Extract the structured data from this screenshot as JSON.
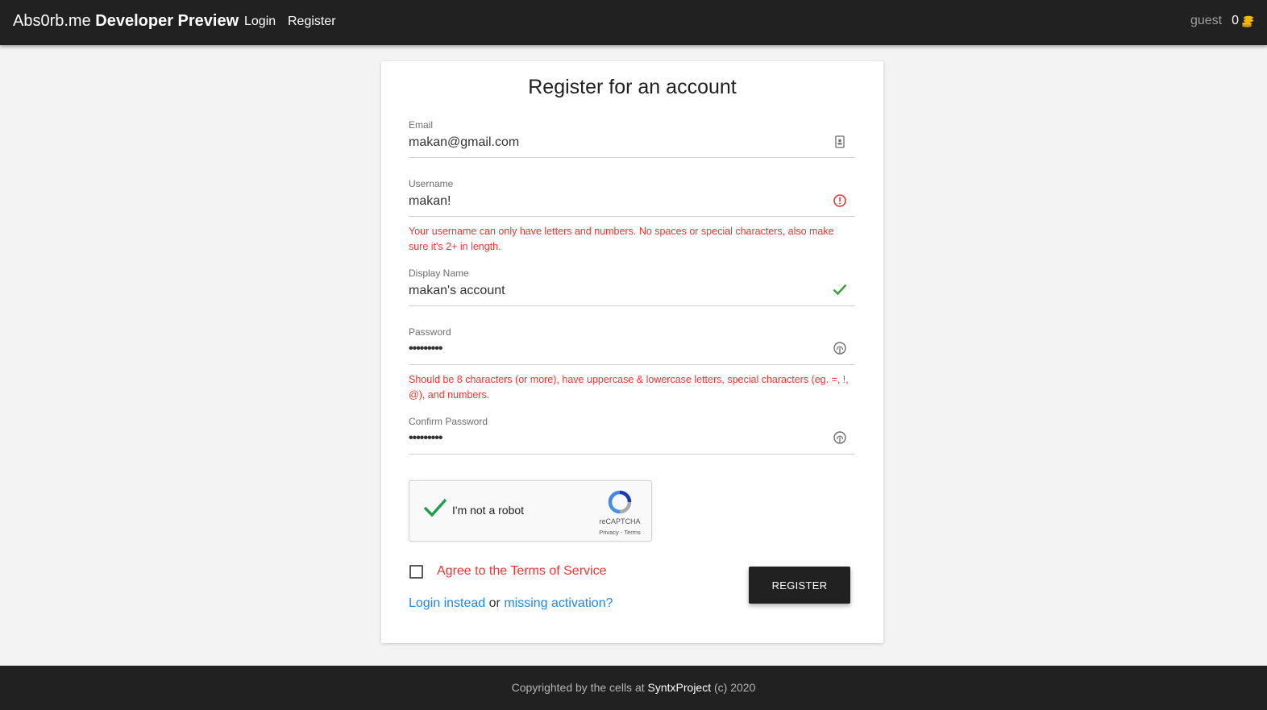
{
  "header": {
    "brand_name": "Abs0rb.me",
    "brand_suffix": "Developer Preview",
    "nav": [
      {
        "label": "Login"
      },
      {
        "label": "Register"
      }
    ],
    "user_name": "guest",
    "coin_count": "0",
    "coin_icon": "coins-icon",
    "accent_color": "#f5b800"
  },
  "form": {
    "title": "Register for an account",
    "fields": {
      "email": {
        "label": "Email",
        "value": "makan@gmail.com",
        "icon": "contact-card-icon"
      },
      "username": {
        "label": "Username",
        "value": "makan!",
        "icon": "error-icon",
        "error": "Your username can only have letters and numbers. No spaces or special characters, also make sure it's 2+ in length."
      },
      "display_name": {
        "label": "Display Name",
        "value": "makan's account",
        "icon": "check-icon"
      },
      "password": {
        "label": "Password",
        "value": "•••••••••",
        "icon": "fingerprint-icon",
        "error": "Should be 8 characters (or more), have uppercase & lowercase letters, special characters (eg. =, !, @), and numbers."
      },
      "confirm_password": {
        "label": "Confirm Password",
        "value": "•••••••••",
        "icon": "fingerprint-icon"
      }
    },
    "captcha": {
      "label": "I'm not a robot",
      "brand": "reCAPTCHA",
      "links": "Privacy - Terms",
      "checked": true
    },
    "terms": {
      "label": "Agree to the Terms of Service",
      "checked": false
    },
    "login_link": "Login instead",
    "or_text": "or",
    "activation_link": "missing activation?",
    "submit_label": "REGISTER"
  },
  "footer": {
    "prefix": "Copyrighted by the cells at",
    "company": "SyntxProject",
    "suffix": "(c) 2020"
  },
  "colors": {
    "bar": "#212121",
    "error": "#e53935",
    "success": "#43a047",
    "link": "#1e88e5"
  }
}
